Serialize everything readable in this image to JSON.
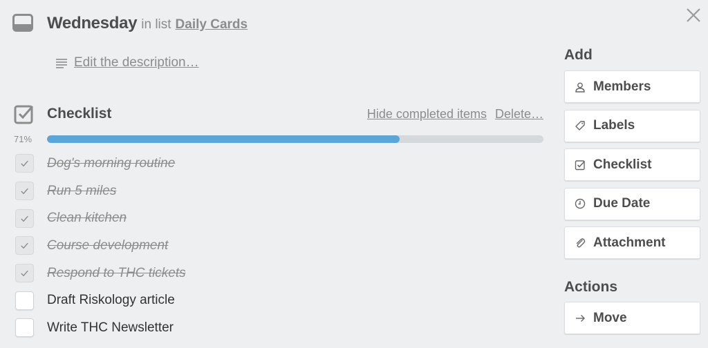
{
  "card": {
    "title": "Wednesday",
    "in_list_text": "in list",
    "list_name": "Daily Cards",
    "description_link": "Edit the description…"
  },
  "checklist": {
    "title": "Checklist",
    "hide_completed": "Hide completed items",
    "delete": "Delete…",
    "percent_label": "71%",
    "progress": 0.71,
    "items": [
      {
        "text": "Dog's morning routine",
        "done": true
      },
      {
        "text": "Run 5 miles",
        "done": true
      },
      {
        "text": "Clean kitchen",
        "done": true
      },
      {
        "text": "Course development",
        "done": true
      },
      {
        "text": "Respond to THC tickets",
        "done": true
      },
      {
        "text": "Draft Riskology article",
        "done": false
      },
      {
        "text": "Write THC Newsletter",
        "done": false
      }
    ]
  },
  "sidebar": {
    "add_title": "Add",
    "add_buttons": [
      {
        "label": "Members",
        "icon": "person-icon"
      },
      {
        "label": "Labels",
        "icon": "tag-icon"
      },
      {
        "label": "Checklist",
        "icon": "checklist-icon"
      },
      {
        "label": "Due Date",
        "icon": "clock-icon"
      },
      {
        "label": "Attachment",
        "icon": "paperclip-icon"
      }
    ],
    "actions_title": "Actions",
    "action_buttons": [
      {
        "label": "Move",
        "icon": "arrow-right-icon"
      }
    ]
  },
  "colors": {
    "progress_fill": "#5aa6d8",
    "progress_track": "#d5d9dc",
    "background": "#edeff0"
  }
}
